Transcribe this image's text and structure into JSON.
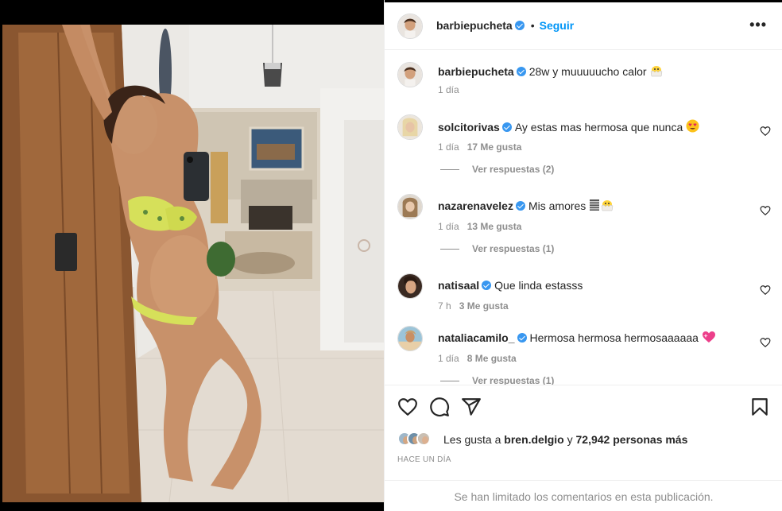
{
  "post": {
    "author": "barbiepucheta",
    "follow_label": "Seguir",
    "more_label": "•••",
    "caption": {
      "username": "barbiepucheta",
      "text": "28w y muuuuucho calor",
      "time": "1 día"
    }
  },
  "comments": [
    {
      "username": "solcitorivas",
      "text": "Ay estas mas hermosa que nunca",
      "time": "1 día",
      "likes": "17 Me gusta",
      "replies": "Ver respuestas (2)"
    },
    {
      "username": "nazarenavelez",
      "text": "Mis amores",
      "time": "1 día",
      "likes": "13 Me gusta",
      "replies": "Ver respuestas (1)"
    },
    {
      "username": "natisaal",
      "text": "Que linda estasss",
      "time": "7 h",
      "likes": "3 Me gusta",
      "replies": ""
    },
    {
      "username": "nataliacamilo_",
      "text": "Hermosa hermosa hermosaaaaaa",
      "time": "1 día",
      "likes": "8 Me gusta",
      "replies": "Ver respuestas (1)"
    }
  ],
  "actions": {
    "like_icon": "heart-outline",
    "comment_icon": "speech-bubble",
    "share_icon": "paper-plane",
    "save_icon": "bookmark"
  },
  "likes": {
    "prefix": "Les gusta a",
    "user": "bren.delgio",
    "joiner": "y",
    "count": "72,942 personas más"
  },
  "posted_ago": "HACE UN DÍA",
  "footer_notice": "Se han limitado los comentarios en esta publicación.",
  "colors": {
    "accent": "#0095f6",
    "verified": "#3897f0",
    "muted": "#8e8e8e",
    "text": "#262626"
  }
}
